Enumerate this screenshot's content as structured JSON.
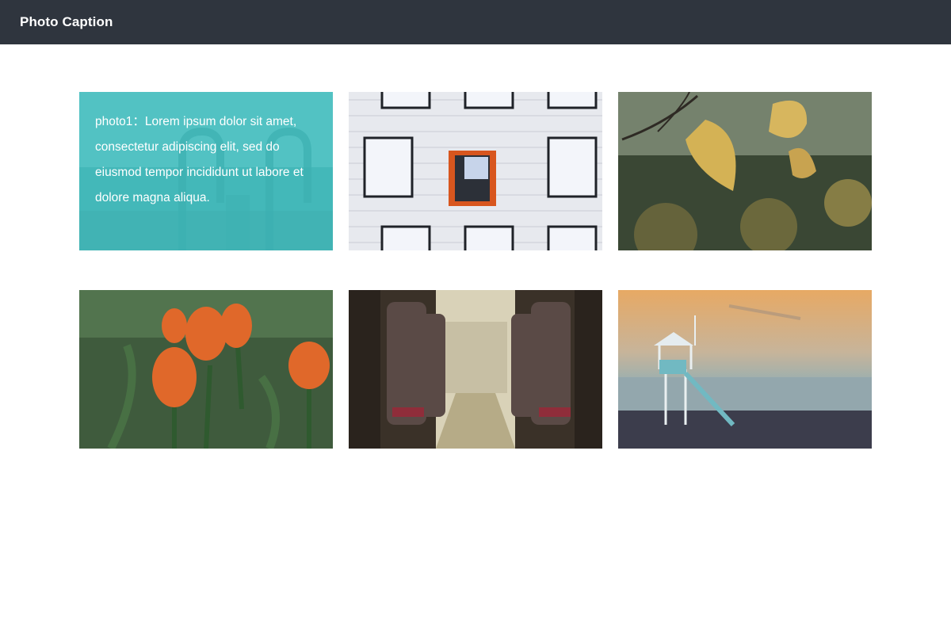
{
  "header": {
    "title": "Photo Caption"
  },
  "photos": [
    {
      "id": "photo1",
      "caption": "photo1：Lorem ipsum dolor sit amet, consectetur adipiscing elit, sed do eiusmod tempor incididunt ut labore et dolore magna aliqua.",
      "subject": "pier-at-sea",
      "caption_visible": true
    },
    {
      "id": "photo2",
      "subject": "building-windows",
      "caption_visible": false
    },
    {
      "id": "photo3",
      "subject": "autumn-leaves",
      "caption_visible": false
    },
    {
      "id": "photo4",
      "subject": "tulips",
      "caption_visible": false
    },
    {
      "id": "photo5",
      "subject": "bus-interior",
      "caption_visible": false
    },
    {
      "id": "photo6",
      "subject": "lifeguard-tower",
      "caption_visible": false
    }
  ],
  "colors": {
    "header_bg": "#2f353e",
    "overlay_teal": "#3ebebe"
  }
}
